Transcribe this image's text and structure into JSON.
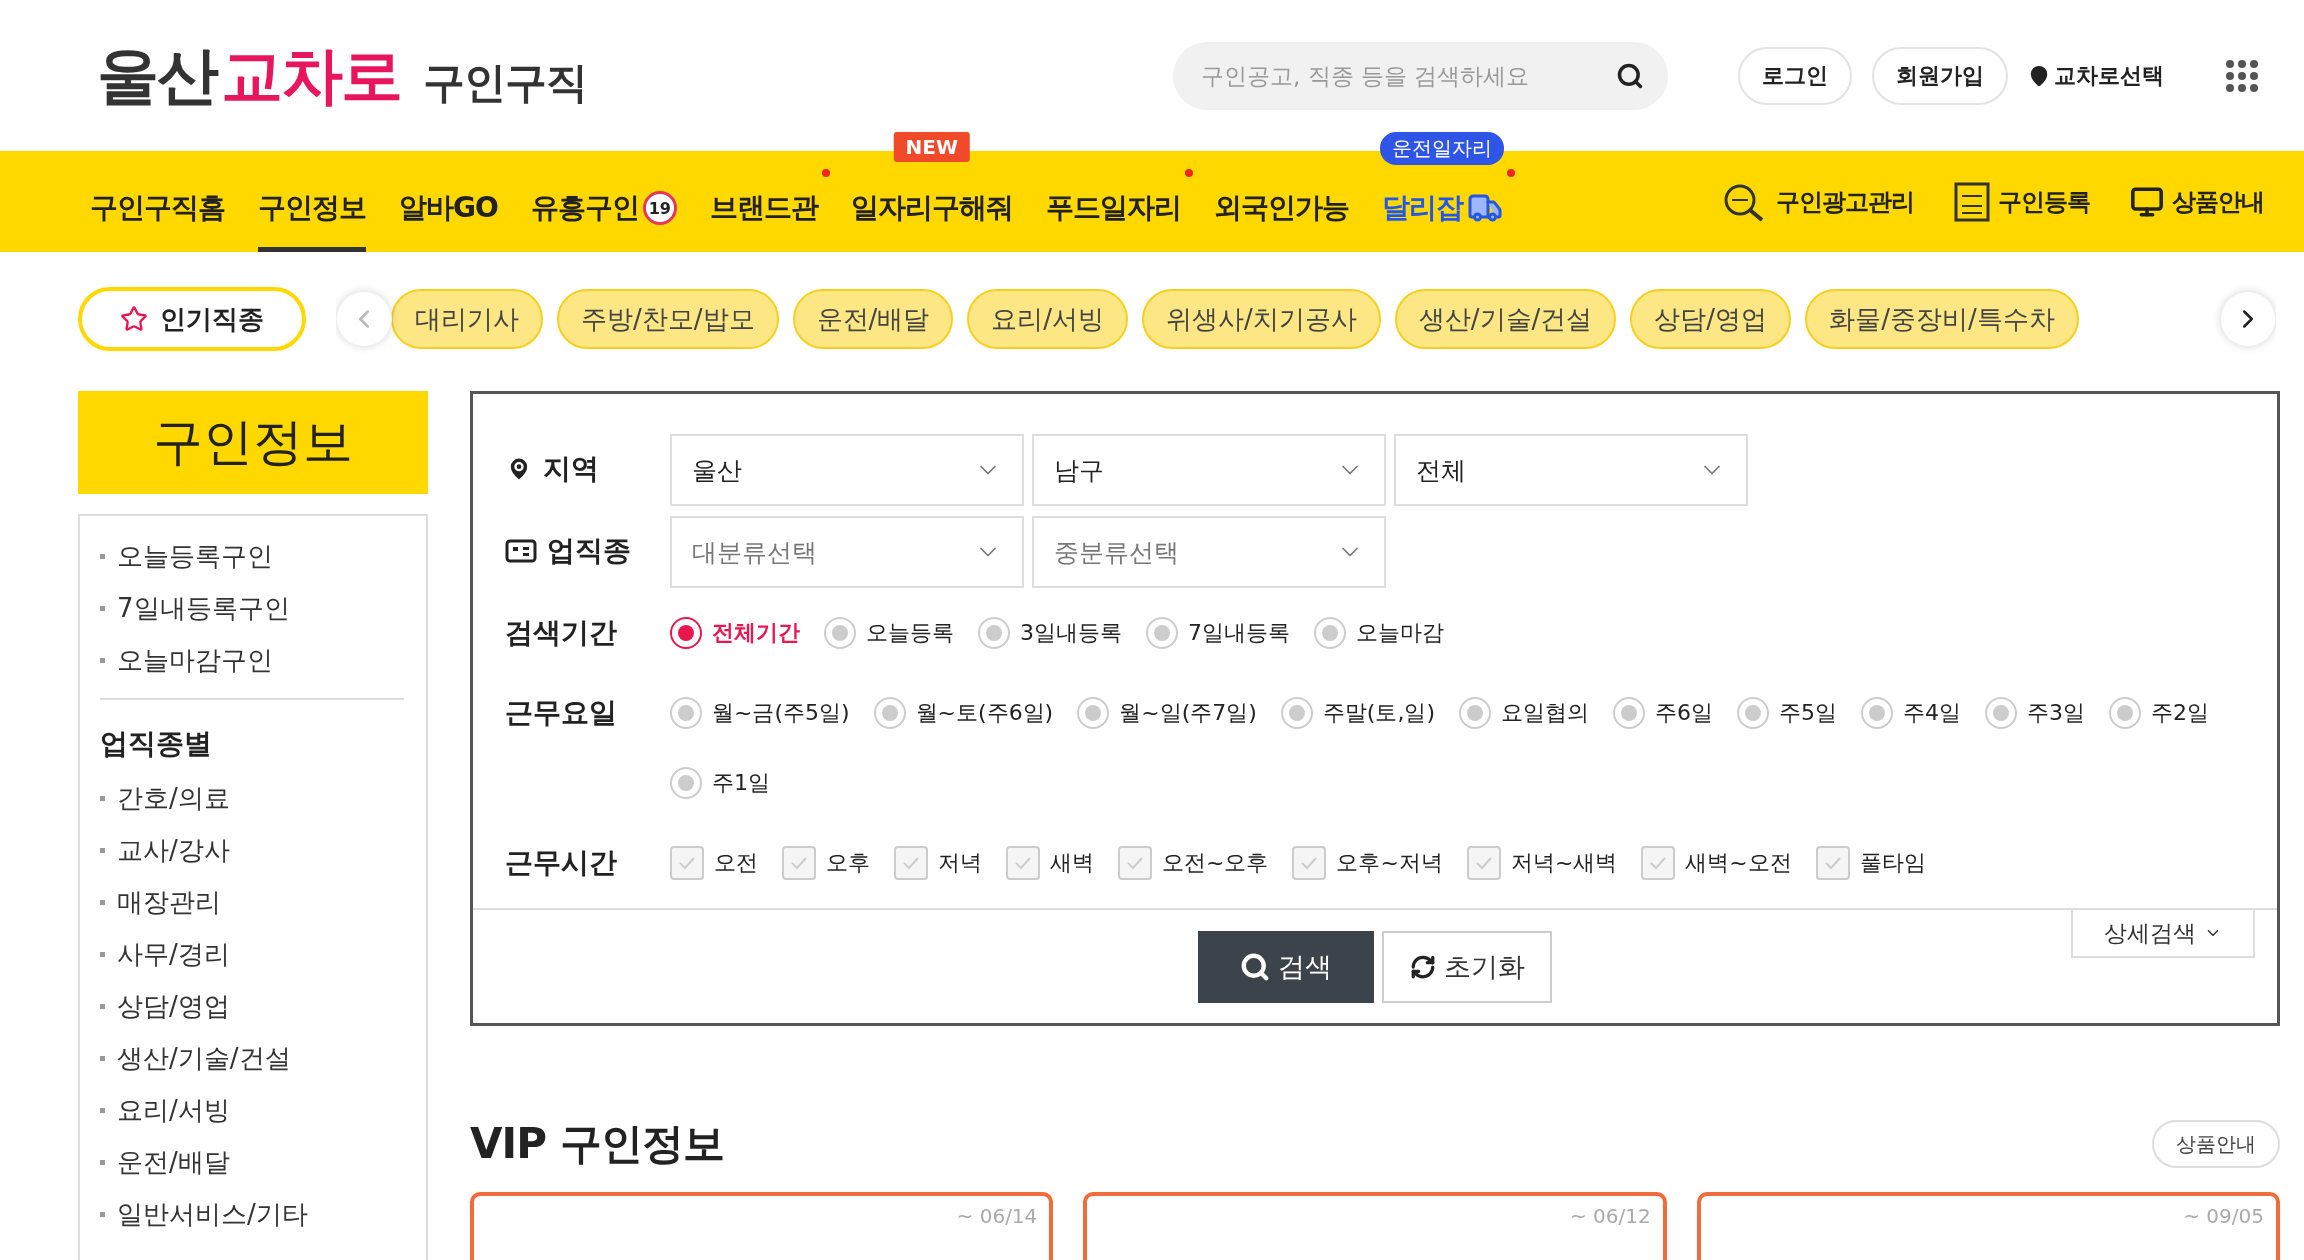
{
  "logo": {
    "region": "울산",
    "brand": "교차로",
    "service": "구인구직"
  },
  "search": {
    "placeholder": "구인공고, 직종 등을 검색하세요"
  },
  "header_links": [
    {
      "label": "로그인",
      "kind": "pill"
    },
    {
      "label": "회원가입",
      "kind": "pill"
    },
    {
      "label": "교차로선택",
      "kind": "location"
    }
  ],
  "nav": [
    {
      "label": "구인구직홈",
      "selected": false,
      "dot": false,
      "kind": "plain"
    },
    {
      "label": "구인정보",
      "selected": true,
      "dot": false,
      "kind": "plain"
    },
    {
      "label": "알바GO",
      "selected": false,
      "dot": false,
      "kind": "plain"
    },
    {
      "label": "유흥구인",
      "selected": false,
      "dot": false,
      "kind": "plain",
      "badge": "19"
    },
    {
      "label": "브랜드관",
      "selected": false,
      "dot": true,
      "kind": "plain"
    },
    {
      "label": "일자리구해줘",
      "selected": false,
      "dot": false,
      "kind": "plain",
      "tag": {
        "text": "NEW",
        "kind": "new"
      }
    },
    {
      "label": "푸드일자리",
      "selected": false,
      "dot": true,
      "kind": "plain"
    },
    {
      "label": "외국인가능",
      "selected": false,
      "dot": false,
      "kind": "plain"
    },
    {
      "label": "달리잡",
      "selected": false,
      "dot": true,
      "kind": "truck",
      "tag": {
        "text": "운전일자리",
        "kind": "info"
      }
    }
  ],
  "nav_tools": [
    {
      "label": "구인광고관리",
      "kind": "job-search"
    },
    {
      "label": "구인등록",
      "kind": "job-doc"
    },
    {
      "label": "상품안내",
      "kind": "monitor"
    }
  ],
  "popular": {
    "label": "인기직종",
    "chips": [
      "대리기사",
      "주방/찬모/밥모",
      "운전/배달",
      "요리/서빙",
      "위생사/치기공사",
      "생산/기술/건설",
      "상담/영업",
      "화물/중장비/특수차"
    ]
  },
  "sidebar": {
    "title": "구인정보",
    "quick": [
      "오늘등록구인",
      "7일내등록구인",
      "오늘마감구인"
    ],
    "section": "업직종별",
    "categories": [
      "간호/의료",
      "교사/강사",
      "매장관리",
      "사무/경리",
      "상담/영업",
      "생산/기술/건설",
      "요리/서빙",
      "운전/배달",
      "일반서비스/기타"
    ]
  },
  "filters": {
    "region": {
      "label": "지역",
      "selects": [
        {
          "value": "울산"
        },
        {
          "value": "남구"
        },
        {
          "value": "전체"
        }
      ]
    },
    "job": {
      "label": "업직종",
      "selects": [
        {
          "placeholder": "대분류선택"
        },
        {
          "placeholder": "중분류선택"
        }
      ]
    },
    "period": {
      "label": "검색기간",
      "options": [
        {
          "label": "전체기간",
          "selected": true
        },
        {
          "label": "오늘등록",
          "selected": false
        },
        {
          "label": "3일내등록",
          "selected": false
        },
        {
          "label": "7일내등록",
          "selected": false
        },
        {
          "label": "오늘마감",
          "selected": false
        }
      ]
    },
    "days": {
      "label": "근무요일",
      "options": [
        {
          "label": "월~금(주5일)",
          "selected": false
        },
        {
          "label": "월~토(주6일)",
          "selected": false
        },
        {
          "label": "월~일(주7일)",
          "selected": false
        },
        {
          "label": "주말(토,일)",
          "selected": false
        },
        {
          "label": "요일협의",
          "selected": false
        },
        {
          "label": "주6일",
          "selected": false
        },
        {
          "label": "주5일",
          "selected": false
        },
        {
          "label": "주4일",
          "selected": false
        },
        {
          "label": "주3일",
          "selected": false
        },
        {
          "label": "주2일",
          "selected": false
        },
        {
          "label": "주1일",
          "selected": false
        }
      ]
    },
    "times": {
      "label": "근무시간",
      "options": [
        {
          "label": "오전",
          "checked": false
        },
        {
          "label": "오후",
          "checked": false
        },
        {
          "label": "저녁",
          "checked": false
        },
        {
          "label": "새벽",
          "checked": false
        },
        {
          "label": "오전~오후",
          "checked": false
        },
        {
          "label": "오후~저녁",
          "checked": false
        },
        {
          "label": "저녁~새벽",
          "checked": false
        },
        {
          "label": "새벽~오전",
          "checked": false
        },
        {
          "label": "풀타임",
          "checked": false
        }
      ]
    },
    "search_button": "검색",
    "reset_button": "초기화",
    "detail_button": "상세검색"
  },
  "vip": {
    "title": "VIP 구인정보",
    "link": "상품안내",
    "cards": [
      {
        "date": "~ 06/14"
      },
      {
        "date": "~ 06/12"
      },
      {
        "date": "~ 09/05"
      }
    ]
  }
}
